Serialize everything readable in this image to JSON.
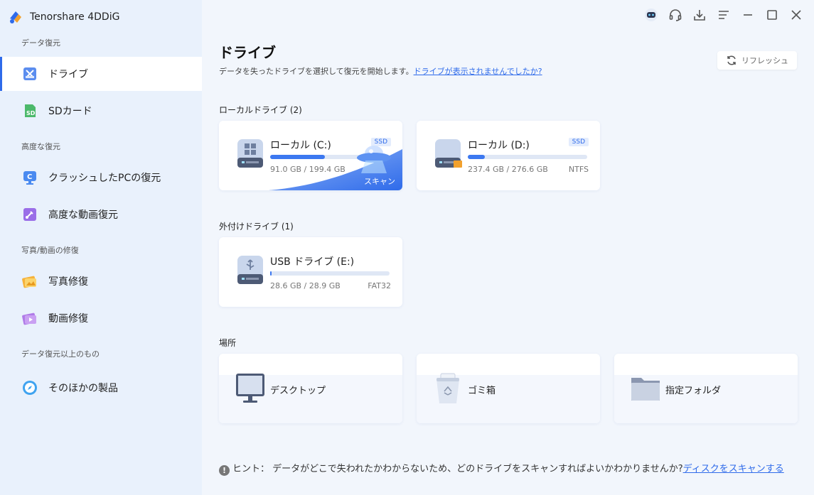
{
  "app": {
    "title": "Tenorshare 4DDiG"
  },
  "sidebar": {
    "sections": [
      {
        "label": "データ復元"
      },
      {
        "label": "高度な復元"
      },
      {
        "label": "写真/動画の修復"
      },
      {
        "label": "データ復元以上のもの"
      }
    ],
    "items": [
      {
        "label": "ドライブ",
        "icon": "drive-icon",
        "active": true
      },
      {
        "label": "SDカード",
        "icon": "sd-card-icon"
      },
      {
        "label": "クラッシュしたPCの復元",
        "icon": "crashed-pc-icon"
      },
      {
        "label": "高度な動画復元",
        "icon": "video-recovery-icon"
      },
      {
        "label": "写真修復",
        "icon": "photo-repair-icon"
      },
      {
        "label": "動画修復",
        "icon": "video-repair-icon"
      },
      {
        "label": "そのほかの製品",
        "icon": "compass-icon"
      }
    ]
  },
  "main": {
    "title": "ドライブ",
    "subtitle": "データを失ったドライブを選択して復元を開始します。",
    "subtitle_link": "ドライブが表示されませんでしたか?",
    "refresh_label": "リフレッシュ",
    "local_group_label": "ローカルドライブ (2)",
    "external_group_label": "外付けドライブ (1)",
    "location_group_label": "場所",
    "drives": [
      {
        "name": "ローカル (C:)",
        "badge": "SSD",
        "size": "91.0 GB / 199.4 GB",
        "usage": 0.456,
        "fs": "",
        "scan_label": "スキャン"
      },
      {
        "name": "ローカル (D:)",
        "badge": "SSD",
        "size": "237.4 GB / 276.6 GB",
        "usage": 0.14,
        "fs": "NTFS"
      },
      {
        "name": "USB ドライブ (E:)",
        "badge": "",
        "size": "28.6 GB / 28.9 GB",
        "usage": 0.01,
        "fs": "FAT32"
      }
    ],
    "locations": [
      {
        "name": "デスクトップ",
        "icon": "desktop-icon"
      },
      {
        "name": "ゴミ箱",
        "icon": "recycle-bin-icon"
      },
      {
        "name": "指定フォルダ",
        "icon": "folder-icon"
      }
    ],
    "hint": {
      "text": "ヒント：  データがどこで失われたかわからないため、どのドライブをスキャンすればよいかわかりませんか?",
      "link": "ディスクをスキャンする"
    }
  },
  "colors": {
    "accent": "#2f6bea",
    "sidebar_bg": "#e9f1fc",
    "main_bg": "#f2f6fc"
  }
}
